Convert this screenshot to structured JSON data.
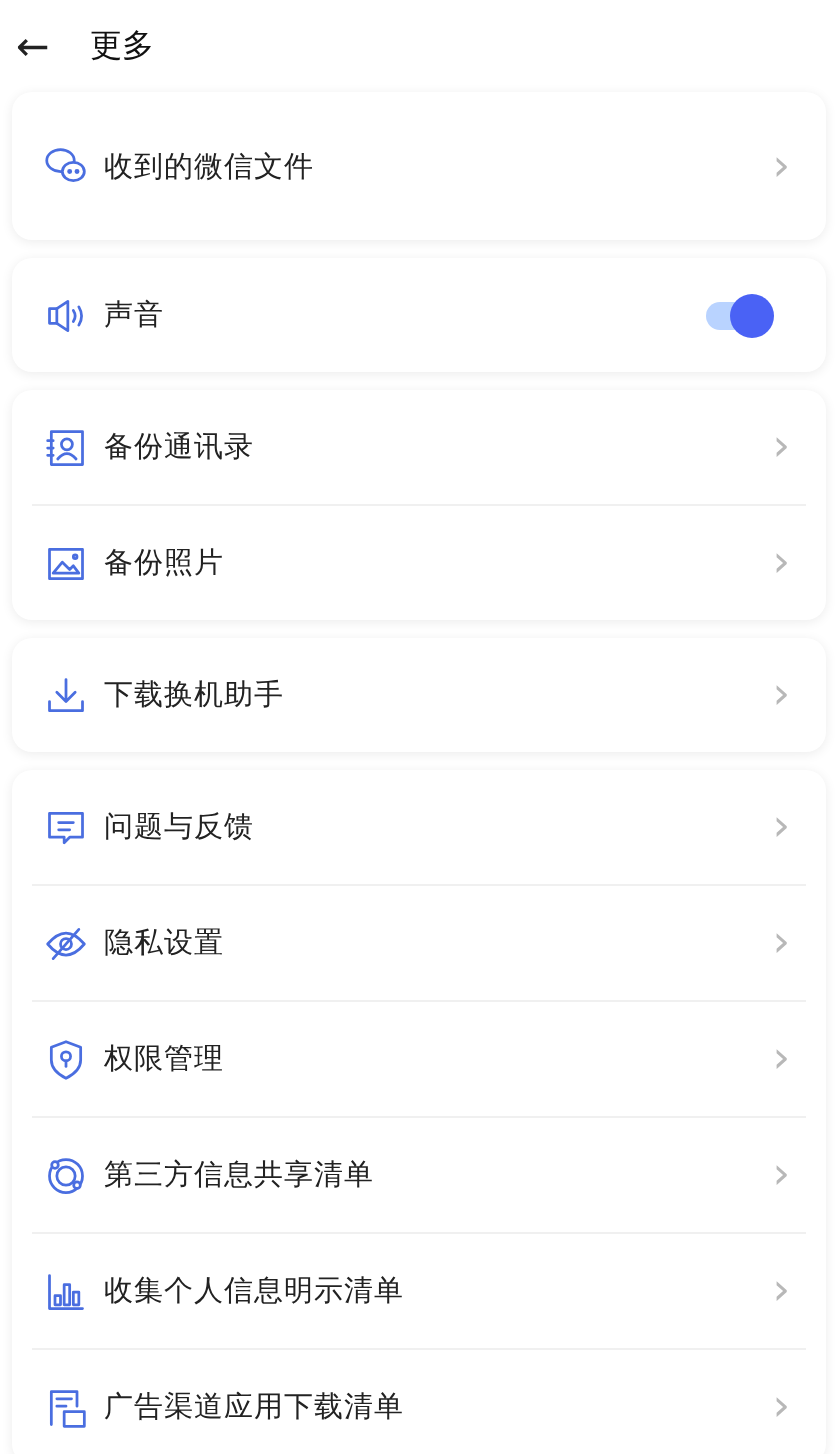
{
  "header": {
    "back": "←",
    "title": "更多"
  },
  "groups": [
    {
      "items": [
        {
          "kind": "link",
          "label": "收到的微信文件",
          "arrow": "›"
        }
      ]
    },
    {
      "items": [
        {
          "kind": "toggle",
          "label": "声音",
          "on": true
        }
      ]
    },
    {
      "items": [
        {
          "kind": "link",
          "label": "备份通讯录",
          "arrow": "›"
        },
        {
          "kind": "link",
          "label": "备份照片",
          "arrow": "›"
        }
      ]
    },
    {
      "items": [
        {
          "kind": "link",
          "label": "下载换机助手",
          "arrow": "›"
        }
      ]
    },
    {
      "items": [
        {
          "kind": "link",
          "label": "问题与反馈",
          "arrow": "›"
        },
        {
          "kind": "link",
          "label": "隐私设置",
          "arrow": "›"
        },
        {
          "kind": "link",
          "label": "权限管理",
          "arrow": "›"
        },
        {
          "kind": "link",
          "label": "第三方信息共享清单",
          "arrow": "›"
        },
        {
          "kind": "link",
          "label": "收集个人信息明示清单",
          "arrow": "›"
        },
        {
          "kind": "link",
          "label": "广告渠道应用下载清单",
          "arrow": "›"
        }
      ]
    }
  ]
}
